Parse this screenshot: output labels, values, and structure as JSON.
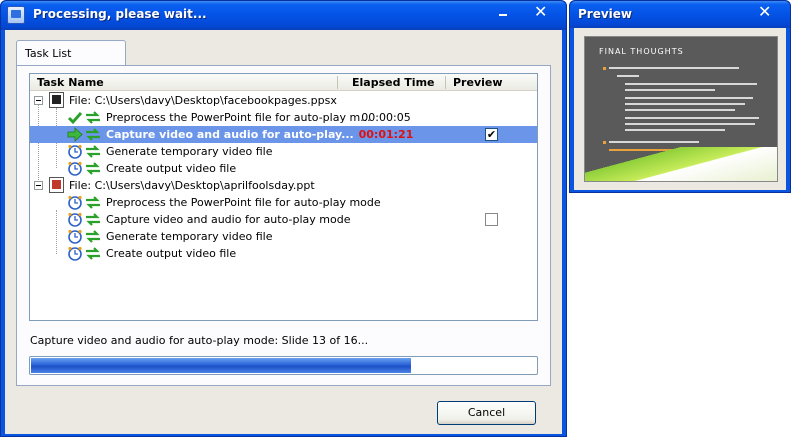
{
  "window": {
    "title": "Processing, please wait...",
    "close_label": "✕"
  },
  "tab": {
    "label": "Task List"
  },
  "list": {
    "columns": [
      "Task Name",
      "Elapsed Time",
      "Preview"
    ],
    "groups": [
      {
        "file": "File: C:\\Users\\davy\\Desktop\\facebookpages.ppsx",
        "tasks": [
          {
            "label": "Preprocess the PowerPoint file for auto-play m...",
            "status": "done",
            "elapsed": "00:00:05"
          },
          {
            "label": "Capture video and audio for auto-play...",
            "status": "active",
            "elapsed": "00:01:21",
            "preview": true
          },
          {
            "label": "Generate temporary video file",
            "status": "pending",
            "elapsed": ""
          },
          {
            "label": "Create output video file",
            "status": "pending",
            "elapsed": ""
          }
        ]
      },
      {
        "file": "File: C:\\Users\\davy\\Desktop\\aprilfoolsday.ppt",
        "tasks": [
          {
            "label": "Preprocess the PowerPoint file for auto-play mode",
            "status": "pending",
            "elapsed": ""
          },
          {
            "label": "Capture video and audio for auto-play mode",
            "status": "pending",
            "elapsed": "",
            "preview": false
          },
          {
            "label": "Generate temporary video file",
            "status": "pending",
            "elapsed": ""
          },
          {
            "label": "Create output video file",
            "status": "pending",
            "elapsed": ""
          }
        ]
      }
    ]
  },
  "status": {
    "text": "Capture video and audio for auto-play mode: Slide 13 of 16..."
  },
  "progress": {
    "fraction": 0.75
  },
  "cancel": {
    "label": "Cancel"
  },
  "preview": {
    "title": "Preview",
    "close_label": "✕",
    "slide_title": "FINAL THOUGHTS"
  },
  "colors": {
    "titlebar": "#0453e6",
    "selection": "#6b95e8",
    "elapsed_active": "#e01010",
    "progress": "#2a64d8"
  }
}
